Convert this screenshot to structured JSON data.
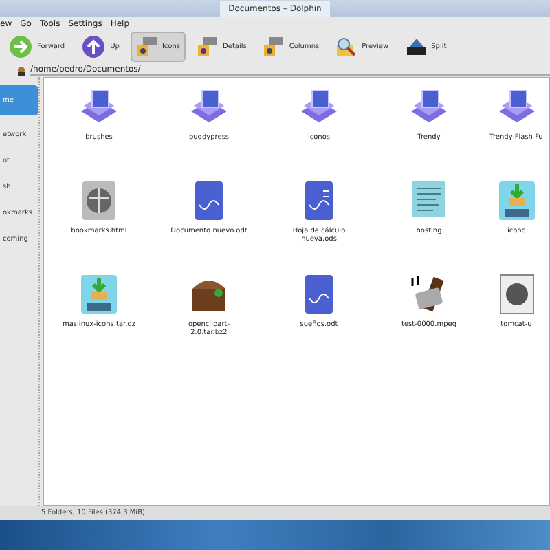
{
  "window": {
    "title": "Documentos – Dolphin"
  },
  "menu": [
    "ew",
    "Go",
    "Tools",
    "Settings",
    "Help"
  ],
  "toolbar": [
    {
      "label": "Forward",
      "kind": "forward",
      "selected": false
    },
    {
      "label": "Up",
      "kind": "up",
      "selected": false
    },
    {
      "label": "Icons",
      "kind": "icons",
      "selected": true
    },
    {
      "label": "Details",
      "kind": "details",
      "selected": false
    },
    {
      "label": "Columns",
      "kind": "columns",
      "selected": false
    },
    {
      "label": "Preview",
      "kind": "preview",
      "selected": false
    },
    {
      "label": "Split",
      "kind": "split",
      "selected": false
    }
  ],
  "location": {
    "path": "/home/pedro/Documentos/"
  },
  "sidebar": {
    "items": [
      {
        "label": "me",
        "selected": true
      },
      {
        "label": "etwork",
        "selected": false
      },
      {
        "label": "ot",
        "selected": false
      },
      {
        "label": "sh",
        "selected": false
      },
      {
        "label": "okmarks",
        "selected": false
      },
      {
        "label": "coming",
        "selected": false
      }
    ]
  },
  "files": [
    {
      "name": "brushes",
      "kind": "folder"
    },
    {
      "name": "buddypress",
      "kind": "folder"
    },
    {
      "name": "iconos",
      "kind": "folder"
    },
    {
      "name": "Trendy",
      "kind": "folder"
    },
    {
      "name": "Trendy Flash Fu",
      "kind": "folder"
    },
    {
      "name": "bookmarks.html",
      "kind": "html"
    },
    {
      "name": "Documento nuevo.odt",
      "kind": "odt"
    },
    {
      "name": "Hoja de cálculo nueva.ods",
      "kind": "ods"
    },
    {
      "name": "hosting",
      "kind": "text"
    },
    {
      "name": "iconc",
      "kind": "zip"
    },
    {
      "name": "maslinux-icons.tar.gz",
      "kind": "tgz"
    },
    {
      "name": "openclipart-2.0.tar.bz2",
      "kind": "archive"
    },
    {
      "name": "sueños.odt",
      "kind": "odt"
    },
    {
      "name": "test-0000.mpeg",
      "kind": "video"
    },
    {
      "name": "tomcat-u",
      "kind": "other"
    }
  ],
  "status_bar": {
    "text": "5 Folders, 10 Files (374,3 MiB)"
  }
}
